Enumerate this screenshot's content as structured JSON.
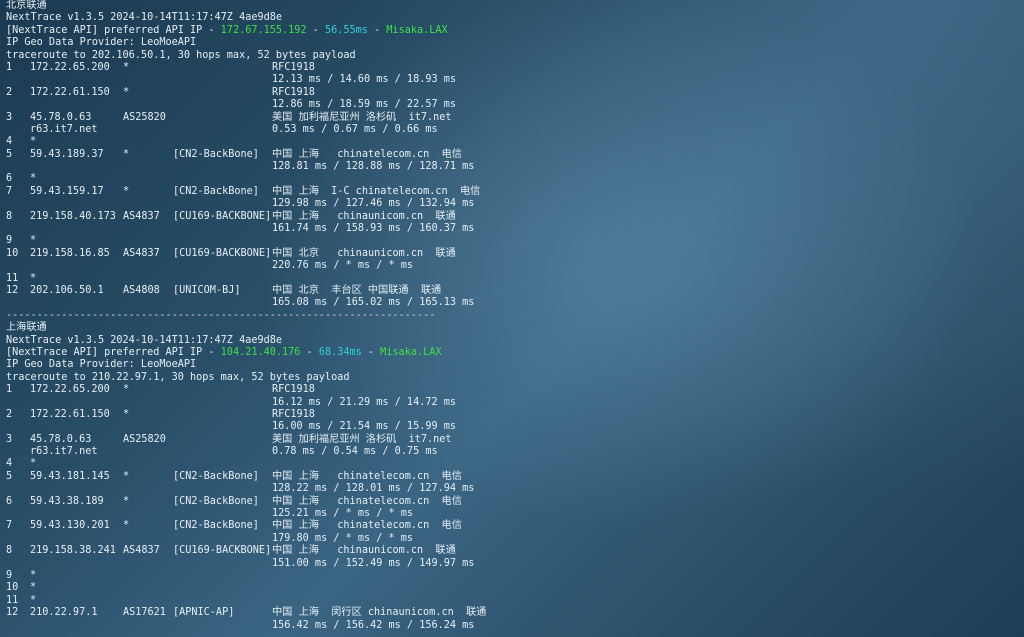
{
  "sections": [
    {
      "title": "北京联通",
      "version": "NextTrace v1.3.5 2024-10-14T11:17:47Z 4ae9d8e",
      "api": {
        "prefix": "[NextTrace API] preferred API IP - ",
        "ip": "172.67.155.192",
        "dash1": " - ",
        "latency": "56.55ms",
        "dash2": " - ",
        "node": "Misaka.LAX"
      },
      "geo_provider": "IP Geo Data Provider: LeoMoeAPI",
      "traceroute": "traceroute to 202.106.50.1, 30 hops max, 52 bytes payload",
      "hops": [
        {
          "hop": "1",
          "ip": "172.22.65.200",
          "as": "*",
          "tag": "",
          "geo": "RFC1918",
          "rtt": "12.13 ms / 14.60 ms / 18.93 ms"
        },
        {
          "hop": "2",
          "ip": "172.22.61.150",
          "as": "*",
          "tag": "",
          "geo": "RFC1918",
          "rtt": "12.86 ms / 18.59 ms / 22.57 ms"
        },
        {
          "hop": "3",
          "ip": "45.78.0.63",
          "as": "AS25820",
          "tag": "",
          "geo": "美国 加利福尼亚州 洛杉矶  it7.net",
          "host": "r63.it7.net",
          "rtt": "0.53 ms / 0.67 ms / 0.66 ms"
        },
        {
          "hop": "4",
          "ip": "*"
        },
        {
          "hop": "5",
          "ip": "59.43.189.37",
          "as": "*",
          "tag": "[CN2-BackBone]",
          "geo": "中国 上海   chinatelecom.cn  电信",
          "rtt": "128.81 ms / 128.88 ms / 128.71 ms"
        },
        {
          "hop": "6",
          "ip": "*"
        },
        {
          "hop": "7",
          "ip": "59.43.159.17",
          "as": "*",
          "tag": "[CN2-BackBone]",
          "geo": "中国 上海  I-C chinatelecom.cn  电信",
          "rtt": "129.98 ms / 127.46 ms / 132.94 ms"
        },
        {
          "hop": "8",
          "ip": "219.158.40.173",
          "as": "AS4837",
          "tag": "[CU169-BACKBONE]",
          "geo": "中国 上海   chinaunicom.cn  联通",
          "rtt": "161.74 ms / 158.93 ms / 160.37 ms"
        },
        {
          "hop": "9",
          "ip": "*"
        },
        {
          "hop": "10",
          "ip": "219.158.16.85",
          "as": "AS4837",
          "tag": "[CU169-BACKBONE]",
          "geo": "中国 北京   chinaunicom.cn  联通",
          "rtt": "220.76 ms / * ms / * ms"
        },
        {
          "hop": "11",
          "ip": "*"
        },
        {
          "hop": "12",
          "ip": "202.106.50.1",
          "as": "AS4808",
          "tag": "[UNICOM-BJ]",
          "geo": "中国 北京  丰台区 中国联通  联通",
          "rtt": "165.08 ms / 165.02 ms / 165.13 ms"
        }
      ]
    },
    {
      "title": "上海联通",
      "version": "NextTrace v1.3.5 2024-10-14T11:17:47Z 4ae9d8e",
      "api": {
        "prefix": "[NextTrace API] preferred API IP - ",
        "ip": "104.21.40.176",
        "dash1": " - ",
        "latency": "68.34ms",
        "dash2": " - ",
        "node": "Misaka.LAX"
      },
      "geo_provider": "IP Geo Data Provider: LeoMoeAPI",
      "traceroute": "traceroute to 210.22.97.1, 30 hops max, 52 bytes payload",
      "hops": [
        {
          "hop": "1",
          "ip": "172.22.65.200",
          "as": "*",
          "tag": "",
          "geo": "RFC1918",
          "rtt": "16.12 ms / 21.29 ms / 14.72 ms"
        },
        {
          "hop": "2",
          "ip": "172.22.61.150",
          "as": "*",
          "tag": "",
          "geo": "RFC1918",
          "rtt": "16.00 ms / 21.54 ms / 15.99 ms"
        },
        {
          "hop": "3",
          "ip": "45.78.0.63",
          "as": "AS25820",
          "tag": "",
          "geo": "美国 加利福尼亚州 洛杉矶  it7.net",
          "host": "r63.it7.net",
          "rtt": "0.78 ms / 0.54 ms / 0.75 ms"
        },
        {
          "hop": "4",
          "ip": "*"
        },
        {
          "hop": "5",
          "ip": "59.43.181.145",
          "as": "*",
          "tag": "[CN2-BackBone]",
          "geo": "中国 上海   chinatelecom.cn  电信",
          "rtt": "128.22 ms / 128.01 ms / 127.94 ms"
        },
        {
          "hop": "6",
          "ip": "59.43.38.189",
          "as": "*",
          "tag": "[CN2-BackBone]",
          "geo": "中国 上海   chinatelecom.cn  电信",
          "rtt": "125.21 ms / * ms / * ms"
        },
        {
          "hop": "7",
          "ip": "59.43.130.201",
          "as": "*",
          "tag": "[CN2-BackBone]",
          "geo": "中国 上海   chinatelecom.cn  电信",
          "rtt": "179.80 ms / * ms / * ms"
        },
        {
          "hop": "8",
          "ip": "219.158.38.241",
          "as": "AS4837",
          "tag": "[CU169-BACKBONE]",
          "geo": "中国 上海   chinaunicom.cn  联通",
          "rtt": "151.00 ms / 152.49 ms / 149.97 ms"
        },
        {
          "hop": "9",
          "ip": "*"
        },
        {
          "hop": "10",
          "ip": "*"
        },
        {
          "hop": "11",
          "ip": "*"
        },
        {
          "hop": "12",
          "ip": "210.22.97.1",
          "as": "AS17621",
          "tag": "[APNIC-AP]",
          "geo": "中国 上海  闵行区 chinaunicom.cn  联通",
          "rtt": "156.42 ms / 156.42 ms / 156.24 ms"
        }
      ]
    }
  ],
  "separator": "----------------------------------------------------------------------",
  "colors": {
    "ip_green": "#3ee046",
    "latency_cyan": "#2fd1d8",
    "node_green": "#3ee046",
    "text": "#e6eef3"
  }
}
